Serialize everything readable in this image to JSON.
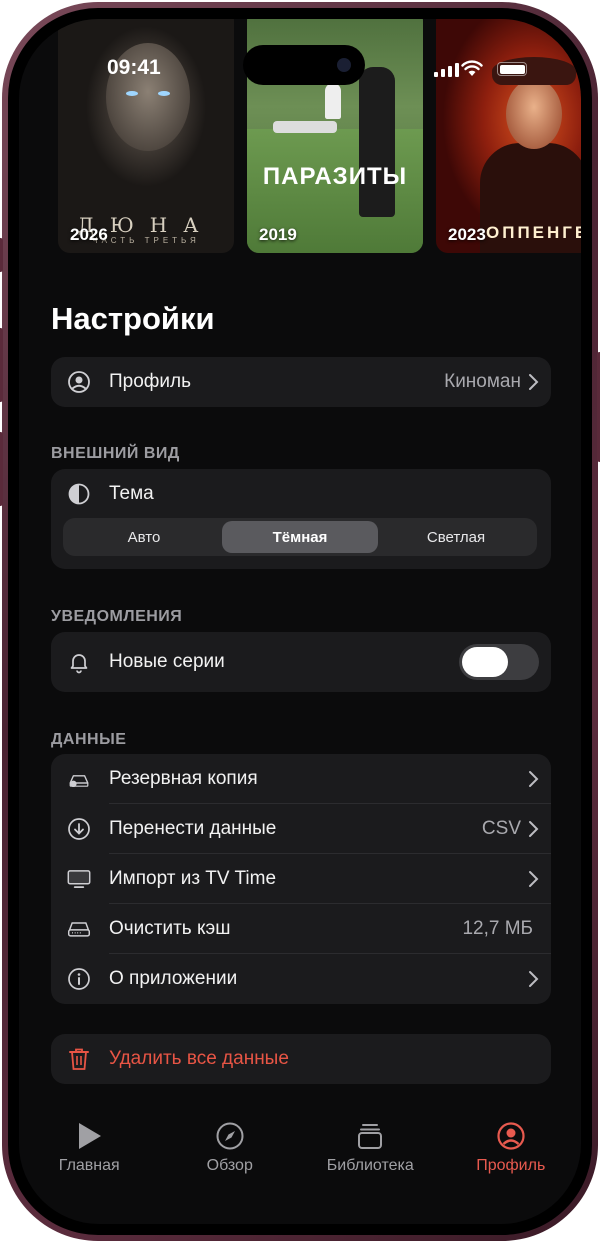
{
  "status_bar": {
    "time": "09:41"
  },
  "posters": [
    {
      "year": "2026",
      "title": "ДЮНА",
      "subtitle": "ЧАСТЬ ТРЕТЬЯ"
    },
    {
      "year": "2019",
      "title": "ПАРАЗИТЫ"
    },
    {
      "year": "2023",
      "title": "ОППЕНГЕЙМЕР"
    }
  ],
  "page_title": "Настройки",
  "profile": {
    "label": "Профиль",
    "value": "Киноман"
  },
  "appearance": {
    "header": "ВНЕШНИЙ ВИД",
    "theme_label": "Тема",
    "options": [
      "Авто",
      "Тёмная",
      "Светлая"
    ],
    "selected": "Тёмная"
  },
  "notifications": {
    "header": "УВЕДОМЛЕНИЯ",
    "new_episodes_label": "Новые серии"
  },
  "data_section": {
    "header": "ДАННЫЕ",
    "items": [
      {
        "label": "Резервная копия",
        "value": "",
        "icon": "cloud-drive-icon"
      },
      {
        "label": "Перенести данные",
        "value": "CSV",
        "icon": "download-circle-icon"
      },
      {
        "label": "Импорт из TV Time",
        "value": "",
        "icon": "tv-icon"
      },
      {
        "label": "Очистить кэш",
        "value": "12,7 МБ",
        "icon": "storage-drive-icon"
      },
      {
        "label": "О приложении",
        "value": "",
        "icon": "info-icon"
      }
    ]
  },
  "danger": {
    "label": "Удалить все данные"
  },
  "tabbar": {
    "tabs": [
      {
        "label": "Главная",
        "icon": "play-icon"
      },
      {
        "label": "Обзор",
        "icon": "compass-icon"
      },
      {
        "label": "Библиотека",
        "icon": "library-icon"
      },
      {
        "label": "Профиль",
        "icon": "profile-icon"
      }
    ],
    "active": "Профиль"
  },
  "colors": {
    "background": "#0b0b0c",
    "card": "#1b1b1d",
    "accent": "#e85a4f",
    "device_frame": "#4a2332"
  }
}
